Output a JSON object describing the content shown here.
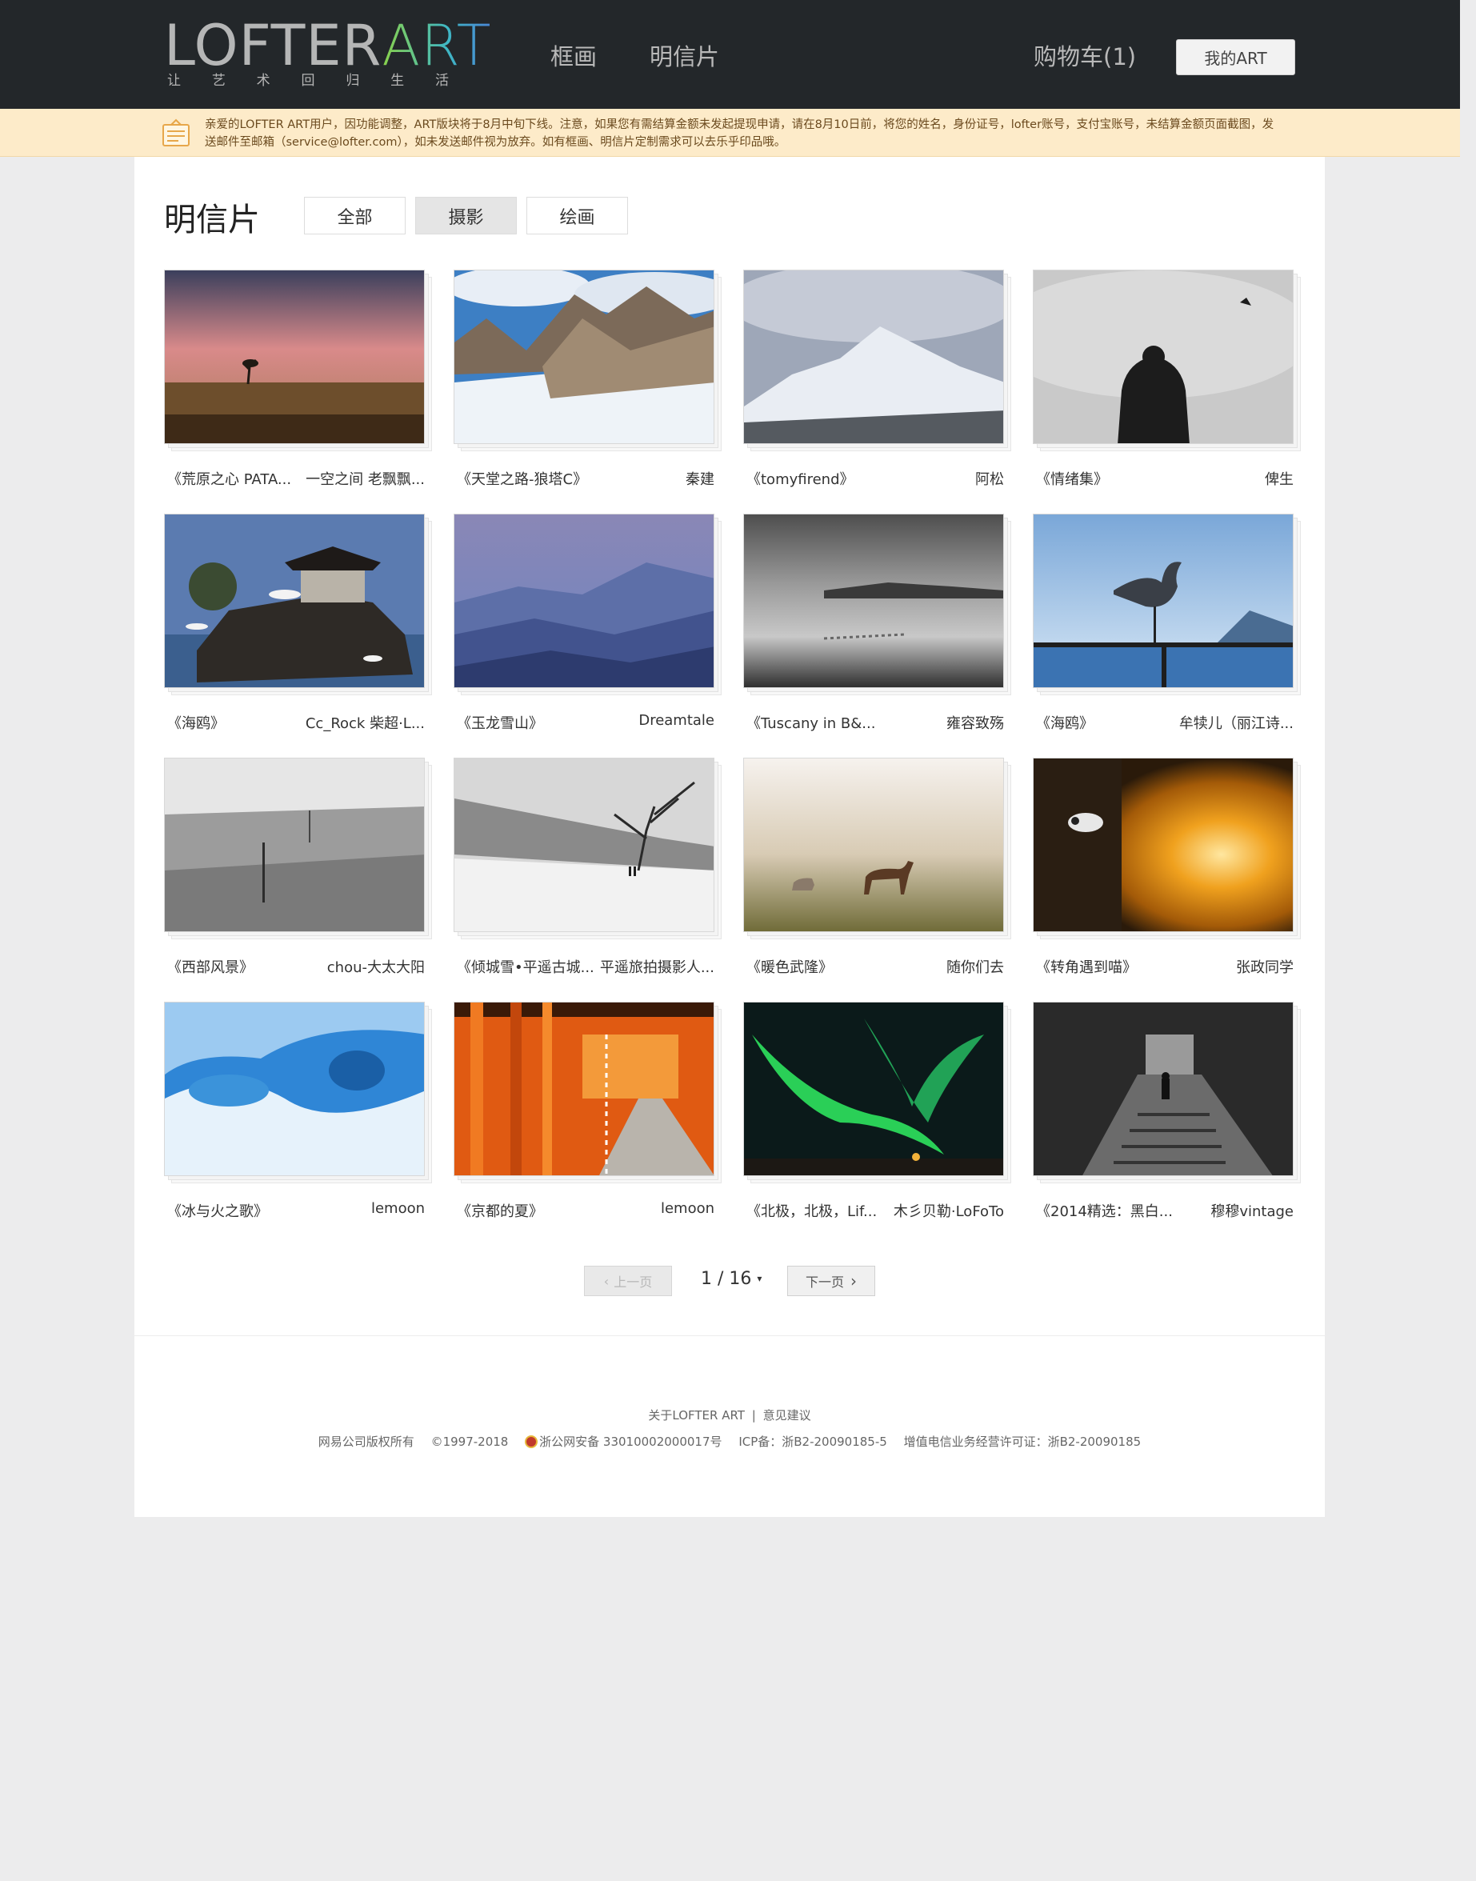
{
  "header": {
    "logo_text_1": "LOFTER",
    "logo_text_2": "ART",
    "logo_sub": [
      "让",
      "艺",
      "术",
      "回",
      "归",
      "生",
      "活"
    ],
    "nav": [
      "框画",
      "明信片"
    ],
    "cart": "购物车(1)",
    "my_art": "我的ART"
  },
  "notice": {
    "text": "亲爱的LOFTER ART用户，因功能调整，ART版块将于8月中旬下线。注意，如果您有需结算金额未发起提现申请，请在8月10日前，将您的姓名，身份证号，lofter账号，支付宝账号，未结算金额页面截图，发送邮件至邮箱（service@lofter.com），如未发送邮件视为放弃。如有框画、明信片定制需求可以去乐乎印品哦。"
  },
  "page": {
    "title": "明信片",
    "filters": [
      "全部",
      "摄影",
      "绘画"
    ],
    "active_filter": "摄影"
  },
  "cards": [
    {
      "title": "《荒原之心 PATA...",
      "author": "一空之间 老飘飘..."
    },
    {
      "title": "《天堂之路-狼塔C》",
      "author": "秦建"
    },
    {
      "title": "《tomyfirend》",
      "author": "阿松"
    },
    {
      "title": "《情绪集》",
      "author": "俾生"
    },
    {
      "title": "《海鸥》",
      "author": "Cc_Rock 柴超·L..."
    },
    {
      "title": "《玉龙雪山》",
      "author": "Dreamtale"
    },
    {
      "title": "《Tuscany in B&...",
      "author": "雍容致殇"
    },
    {
      "title": "《海鸥》",
      "author": "牟犊儿（丽江诗..."
    },
    {
      "title": "《西部风景》",
      "author": "chou-大太大阳"
    },
    {
      "title": "《倾城雪•平遥古城...",
      "author": "平遥旅拍摄影人..."
    },
    {
      "title": "《暖色武隆》",
      "author": "随你们去"
    },
    {
      "title": "《转角遇到喵》",
      "author": "张政同学"
    },
    {
      "title": "《冰与火之歌》",
      "author": "lemoon"
    },
    {
      "title": "《京都的夏》",
      "author": "lemoon"
    },
    {
      "title": "《北极，北极，Lif...",
      "author": "木彡贝勒·LoFoTo"
    },
    {
      "title": "《2014精选：黑白...",
      "author": "穆穆vintage"
    }
  ],
  "pager": {
    "prev": "上一页",
    "current": "1 / 16",
    "next": "下一页"
  },
  "footer": {
    "about": "关于LOFTER ART",
    "sep": "|",
    "feedback": "意见建议",
    "copyright": "网易公司版权所有",
    "years": "©1997-2018",
    "police": "浙公网安备 33010002000017号",
    "icp": "ICP备：浙B2-20090185-5",
    "license": "增值电信业务经营许可证：浙B2-20090185"
  }
}
